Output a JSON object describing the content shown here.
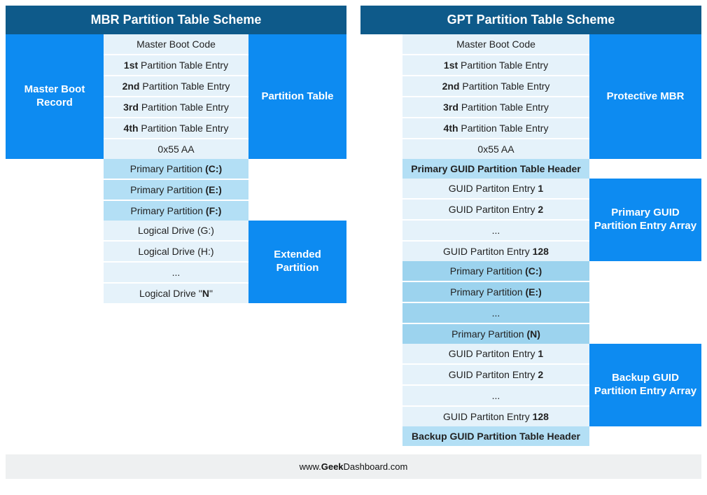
{
  "mbr": {
    "title": "MBR Partition Table Scheme",
    "left_label1": "Master Boot Record",
    "right_label1": "Partition Table",
    "right_label2": "Extended Partition",
    "rows": {
      "r0": "Master Boot Code",
      "r1a": "1st",
      "r1b": " Partition Table Entry",
      "r2a": "2nd",
      "r2b": " Partition Table Entry",
      "r3a": "3rd",
      "r3b": " Partition Table Entry",
      "r4a": "4th",
      "r4b": " Partition Table Entry",
      "r5": "0x55 AA",
      "p1a": "Primary Partition ",
      "p1b": "(C:)",
      "p2a": "Primary Partition ",
      "p2b": "(E:)",
      "p3a": "Primary Partition ",
      "p3b": "(F:)",
      "l1": "Logical Drive (G:)",
      "l2": "Logical Drive (H:)",
      "l3": "...",
      "l4a": "Logical Drive \"",
      "l4b": "N",
      "l4c": "\""
    }
  },
  "gpt": {
    "title": "GPT Partition Table Scheme",
    "right_label1": "Protective MBR",
    "right_label2": "Primary GUID Partition Entry Array",
    "right_label3": "Backup GUID Partition Entry Array",
    "rows": {
      "r0": "Master Boot Code",
      "r1a": "1st",
      "r1b": " Partition Table Entry",
      "r2a": "2nd",
      "r2b": " Partition Table Entry",
      "r3a": "3rd",
      "r3b": " Partition Table Entry",
      "r4a": "4th",
      "r4b": " Partition Table Entry",
      "r5": "0x55 AA",
      "h1": "Primary GUID Partition Table Header",
      "g1a": "GUID Partiton Entry ",
      "g1b": "1",
      "g2a": "GUID Partiton Entry ",
      "g2b": "2",
      "g3": "...",
      "g4a": "GUID Partiton Entry ",
      "g4b": "128",
      "p1a": "Primary Partition ",
      "p1b": "(C:)",
      "p2a": "Primary Partition ",
      "p2b": "(E:)",
      "p3": "...",
      "p4a": "Primary Partition ",
      "p4b": "(N)",
      "b1a": "GUID Partiton Entry ",
      "b1b": "1",
      "b2a": "GUID Partiton Entry ",
      "b2b": "2",
      "b3": "...",
      "b4a": "GUID Partiton Entry ",
      "b4b": "128",
      "h2": "Backup GUID Partition Table Header"
    }
  },
  "footer_a": "www.",
  "footer_b": "Geek",
  "footer_c": "Dashboard.com"
}
